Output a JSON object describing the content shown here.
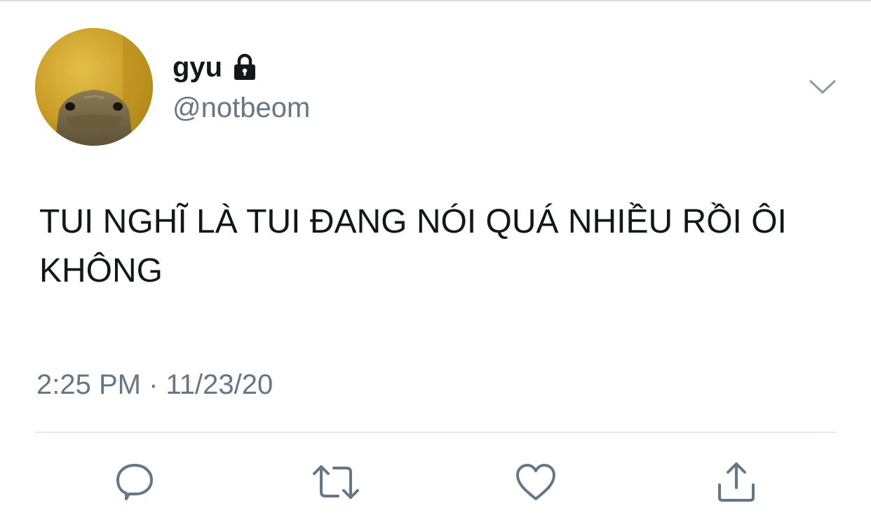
{
  "tweet": {
    "author": {
      "display_name": "gyu",
      "handle": "@notbeom",
      "protected_icon": "lock-icon",
      "avatar": "lizard-photo"
    },
    "text": "TUI NGHĨ LÀ TUI ĐANG NÓI QUÁ NHIỀU RỒI ÔI KHÔNG",
    "timestamp": "2:25 PM · 11/23/20",
    "menu_icon": "chevron-down-icon",
    "actions": [
      {
        "name": "reply",
        "icon": "speech-bubble-icon"
      },
      {
        "name": "retweet",
        "icon": "retweet-icon"
      },
      {
        "name": "like",
        "icon": "heart-icon"
      },
      {
        "name": "share",
        "icon": "share-icon"
      }
    ]
  },
  "colors": {
    "text_primary": "#14171a",
    "text_secondary": "#657786",
    "divider": "#e1e8ed",
    "icon": "#657786"
  }
}
